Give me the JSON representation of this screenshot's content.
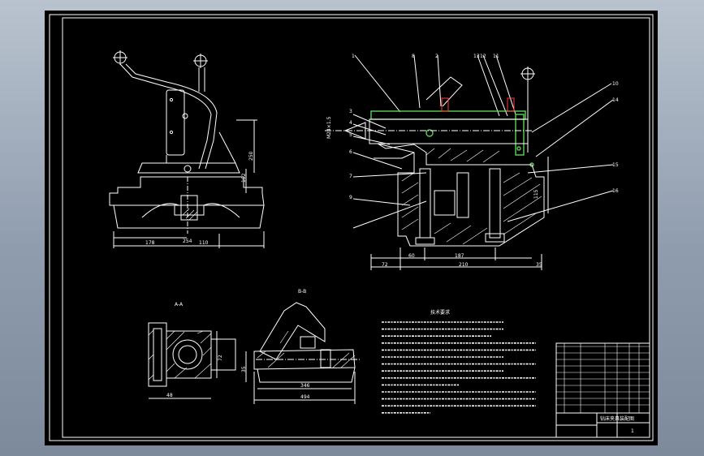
{
  "drawing": {
    "background_color": "#000000",
    "line_color": "#ffffff",
    "highlight_color": "#5ad25a",
    "accent_color": "#ff3b3b"
  },
  "section_labels": {
    "section_a": "A-A",
    "section_b": "B-B"
  },
  "front_view_dims": {
    "d1": "178",
    "d2": "254",
    "d3": "110",
    "v1": "250",
    "v2": "102"
  },
  "side_view_dims": {
    "d1": "72",
    "d2": "60",
    "d3": "187",
    "d4": "210",
    "d5": "35",
    "v1": "115"
  },
  "section_b_dims": {
    "d1": "346",
    "d2": "494",
    "v1": "35"
  },
  "section_a_dims": {
    "d1": "48",
    "v1": "72"
  },
  "part_callouts": [
    "1",
    "8",
    "2",
    "13",
    "12",
    "11",
    "10",
    "14",
    "15",
    "16",
    "3",
    "4",
    "5",
    "6",
    "7",
    "9"
  ],
  "technical_requirements": {
    "title": "技术要求"
  },
  "title_block": {
    "name": "钻床夹具装配图",
    "sheet": "1"
  }
}
